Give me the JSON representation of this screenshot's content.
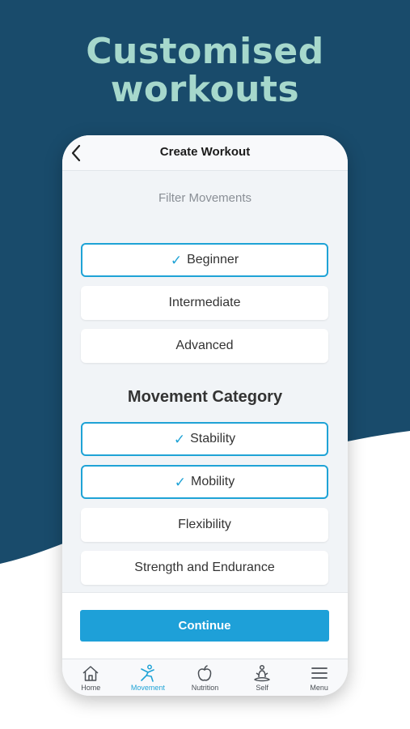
{
  "promo": {
    "headline_line1": "Customised",
    "headline_line2": "workouts",
    "colors": {
      "background": "#194b6b",
      "headline": "#a6d8cc",
      "accent": "#1fa3d6"
    }
  },
  "screen": {
    "title": "Create Workout",
    "back_icon": "chevron-left-icon",
    "subtitle": "Filter Movements",
    "levels": [
      {
        "label": "Beginner",
        "selected": true
      },
      {
        "label": "Intermediate",
        "selected": false
      },
      {
        "label": "Advanced",
        "selected": false
      }
    ],
    "category_title": "Movement Category",
    "categories": [
      {
        "label": "Stability",
        "selected": true
      },
      {
        "label": "Mobility",
        "selected": true
      },
      {
        "label": "Flexibility",
        "selected": false
      },
      {
        "label": "Strength and Endurance",
        "selected": false
      }
    ],
    "continue_label": "Continue"
  },
  "tabbar": {
    "items": [
      {
        "label": "Home",
        "icon": "home-icon",
        "active": false
      },
      {
        "label": "Movement",
        "icon": "movement-icon",
        "active": true
      },
      {
        "label": "Nutrition",
        "icon": "apple-icon",
        "active": false
      },
      {
        "label": "Self",
        "icon": "meditation-icon",
        "active": false
      },
      {
        "label": "Menu",
        "icon": "hamburger-menu-icon",
        "active": false
      }
    ]
  }
}
